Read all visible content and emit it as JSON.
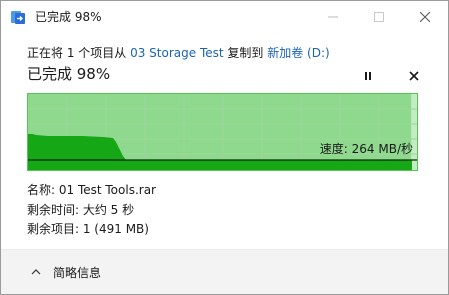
{
  "window": {
    "title": "已完成 98%",
    "icon": "file-copy-icon",
    "controls": [
      "minimize-icon",
      "maximize-icon",
      "close-icon"
    ]
  },
  "header": {
    "prefix": "正在将 1 个项目从 ",
    "source": "03 Storage Test",
    "middle": " 复制到 ",
    "destination": "新加卷 (D:)"
  },
  "status": {
    "text": "已完成 98%",
    "progress_percent": 98
  },
  "graph": {
    "speed_text": "速度: 264 MB/秒",
    "current_speed_mb_s": 264
  },
  "info": {
    "name": "名称: 01 Test Tools.rar",
    "time_remaining": "剩余时间: 大约 5 秒",
    "items_remaining": "剩余项目: 1 (491 MB)"
  },
  "footer": {
    "details_label": "简略信息"
  },
  "colors": {
    "accent_link": "#1a64b5",
    "graph_fill_light": "#c2ecc2",
    "graph_progress": "#8fd98f",
    "graph_dark": "#16a716",
    "graph_border": "#56c456"
  }
}
